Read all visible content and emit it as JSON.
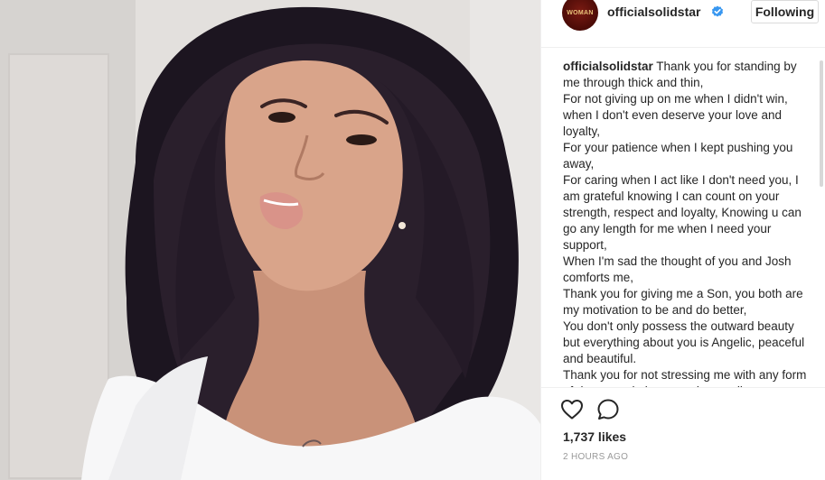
{
  "header": {
    "avatar_text": "WOMAN",
    "username": "officialsolidstar",
    "follow_label": "Following"
  },
  "caption": {
    "user": "officialsolidstar",
    "text": "Thank you for standing by me through thick and thin,\nFor not giving up on me when I didn't win, when I don't even deserve your love and loyalty,\nFor your patience when I kept pushing you away,\nFor caring when I act like I don't need you, I am grateful knowing I can count on your strength, respect and loyalty, Knowing u can go any length for me when I need your support,\nWhen I'm sad the thought of you and Josh comforts me,\nThank you for giving me a Son, you both are my motivation to be and do better,\nYou don't only possess the outward beauty but everything about you is Angelic, peaceful and beautiful.\nThank you for not stressing me with any form of drama and always understanding"
  },
  "footer": {
    "likes": "1,737 likes",
    "time": "2 HOURS AGO"
  },
  "colors": {
    "verified": "#3897f0",
    "text": "#262626",
    "muted": "#999999",
    "border": "#efefef"
  },
  "icons": {
    "verified": "verified-badge-icon",
    "like": "heart-icon",
    "comment": "comment-bubble-icon"
  }
}
